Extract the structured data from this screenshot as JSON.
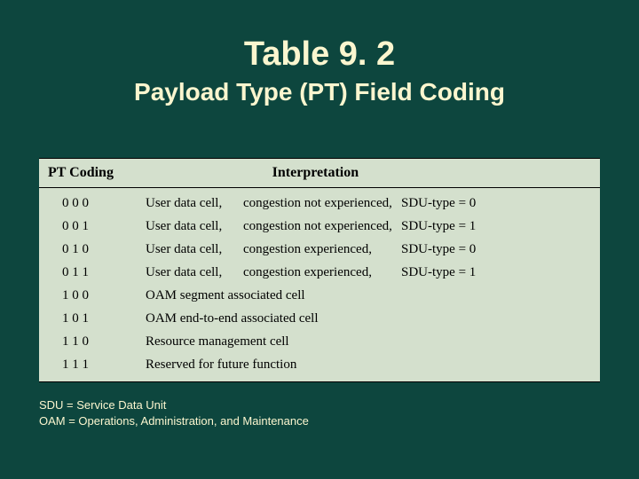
{
  "title": "Table 9. 2",
  "subtitle": "Payload Type (PT) Field Coding",
  "headers": {
    "code": "PT Coding",
    "interp": "Interpretation"
  },
  "rows": [
    {
      "code": "0 0 0",
      "part1": "User data cell,",
      "part2": "congestion not experienced,",
      "sdu": "SDU-type = 0"
    },
    {
      "code": "0 0 1",
      "part1": "User data cell,",
      "part2": "congestion not experienced,",
      "sdu": "SDU-type = 1"
    },
    {
      "code": "0 1 0",
      "part1": "User data cell,",
      "part2": "congestion experienced,",
      "sdu": "SDU-type = 0"
    },
    {
      "code": "0 1 1",
      "part1": "User data cell,",
      "part2": "congestion experienced,",
      "sdu": "SDU-type = 1"
    },
    {
      "code": "1 0 0",
      "part1": "OAM segment associated cell",
      "part2": "",
      "sdu": ""
    },
    {
      "code": "1 0 1",
      "part1": "OAM end-to-end associated cell",
      "part2": "",
      "sdu": ""
    },
    {
      "code": "1 1 0",
      "part1": "Resource management cell",
      "part2": "",
      "sdu": ""
    },
    {
      "code": "1 1 1",
      "part1": "Reserved for future function",
      "part2": "",
      "sdu": ""
    }
  ],
  "footnotes": {
    "line1": "SDU  =  Service Data Unit",
    "line2": "OAM  =  Operations, Administration, and Maintenance"
  },
  "chart_data": {
    "type": "table",
    "title": "Table 9.2 Payload Type (PT) Field Coding",
    "columns": [
      "PT Coding",
      "Interpretation"
    ],
    "rows": [
      [
        "0 0 0",
        "User data cell, congestion not experienced, SDU-type = 0"
      ],
      [
        "0 0 1",
        "User data cell, congestion not experienced, SDU-type = 1"
      ],
      [
        "0 1 0",
        "User data cell, congestion experienced, SDU-type = 0"
      ],
      [
        "0 1 1",
        "User data cell, congestion experienced, SDU-type = 1"
      ],
      [
        "1 0 0",
        "OAM segment associated cell"
      ],
      [
        "1 0 1",
        "OAM end-to-end associated cell"
      ],
      [
        "1 1 0",
        "Resource management cell"
      ],
      [
        "1 1 1",
        "Reserved for future function"
      ]
    ],
    "footnotes": [
      "SDU = Service Data Unit",
      "OAM = Operations, Administration, and Maintenance"
    ]
  }
}
